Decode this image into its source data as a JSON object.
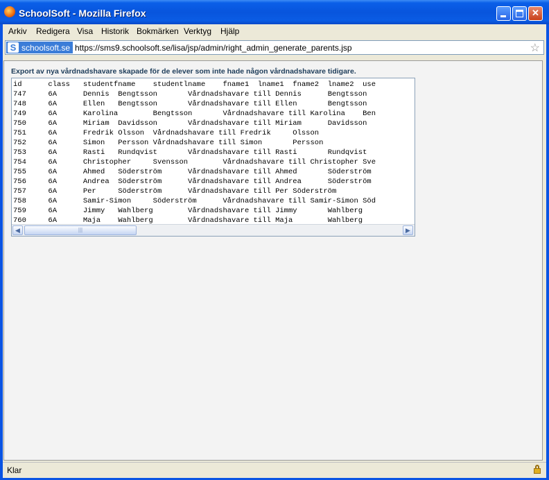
{
  "window": {
    "title": "SchoolSoft - Mozilla Firefox"
  },
  "menu": [
    "Arkiv",
    "Redigera",
    "Visa",
    "Historik",
    "Bokmärken",
    "Verktyg",
    "Hjälp"
  ],
  "urlbar": {
    "site": "schoolsoft.se",
    "url": "https://sms9.schoolsoft.se/lisa/jsp/admin/right_admin_generate_parents.jsp"
  },
  "page": {
    "heading": "Export av nya vårdnadshavare skapade för de elever som inte hade någon vårdnadshavare tidigare.",
    "export_text": "id\tclass\tstudentfname\tstudentlname\tfname1\tlname1\tfname2\tlname2\tuse\n747\t6A\tDennis\tBengtsson\tVårdnadshavare till Dennis\tBengtsson\n748\t6A\tEllen\tBengtsson\tVårdnadshavare till Ellen\tBengtsson\n749\t6A\tKarolina\tBengtsson\tVårdnadshavare till Karolina\tBen\n750\t6A\tMiriam\tDavidsson\tVårdnadshavare till Miriam\tDavidsson\n751\t6A\tFredrik\tOlsson\tVårdnadshavare till Fredrik\tOlsson\n752\t6A\tSimon\tPersson\tVårdnadshavare till Simon\tPersson\n753\t6A\tRasti\tRundqvist\tVårdnadshavare till Rasti\tRundqvist\n754\t6A\tChristopher\tSvensson\tVårdnadshavare till Christopher\tSve\n755\t6A\tAhmed\tSöderström\tVårdnadshavare till Ahmed\tSöderström\n756\t6A\tAndrea\tSöderström\tVårdnadshavare till Andrea\tSöderström\n757\t6A\tPer\tSöderström\tVårdnadshavare till Per\tSöderström\n758\t6A\tSamir-Simon\tSöderström\tVårdnadshavare till Samir-Simon\tSöd\n759\t6A\tJimmy\tWahlberg\tVårdnadshavare till Jimmy\tWahlberg\n760\t6A\tMaja\tWahlberg\tVårdnadshavare till Maja\tWahlberg"
  },
  "status": {
    "text": "Klar"
  }
}
